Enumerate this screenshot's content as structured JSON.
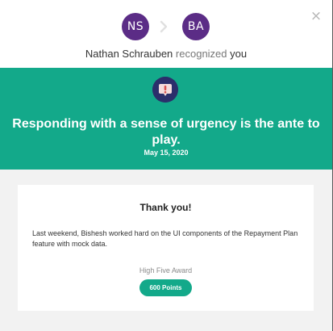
{
  "recognition": {
    "from_initials": "NS",
    "to_initials": "BA",
    "giver_name": "Nathan Schrauben",
    "action_text": "recognized",
    "recipient_text": "you",
    "value_statement": "Responding with a sense of urgency is the ante to play.",
    "date": "May 15, 2020"
  },
  "card": {
    "title": "Thank you!",
    "message": "Last weekend, Bishesh worked hard on the UI components of the Repayment Plan feature with mock data.",
    "award_name": "High Five Award",
    "points": "600 Points"
  },
  "colors": {
    "avatar": "#5b2c86",
    "band": "#13a98a",
    "badge": "#2b2f6b",
    "badge_mark": "#d9534f",
    "points_pill": "#13a98a",
    "content_bg": "#f2f2f2"
  },
  "icons": {
    "close": "close-icon",
    "arrow": "chevron-right-icon",
    "badge": "alert-badge-icon"
  }
}
